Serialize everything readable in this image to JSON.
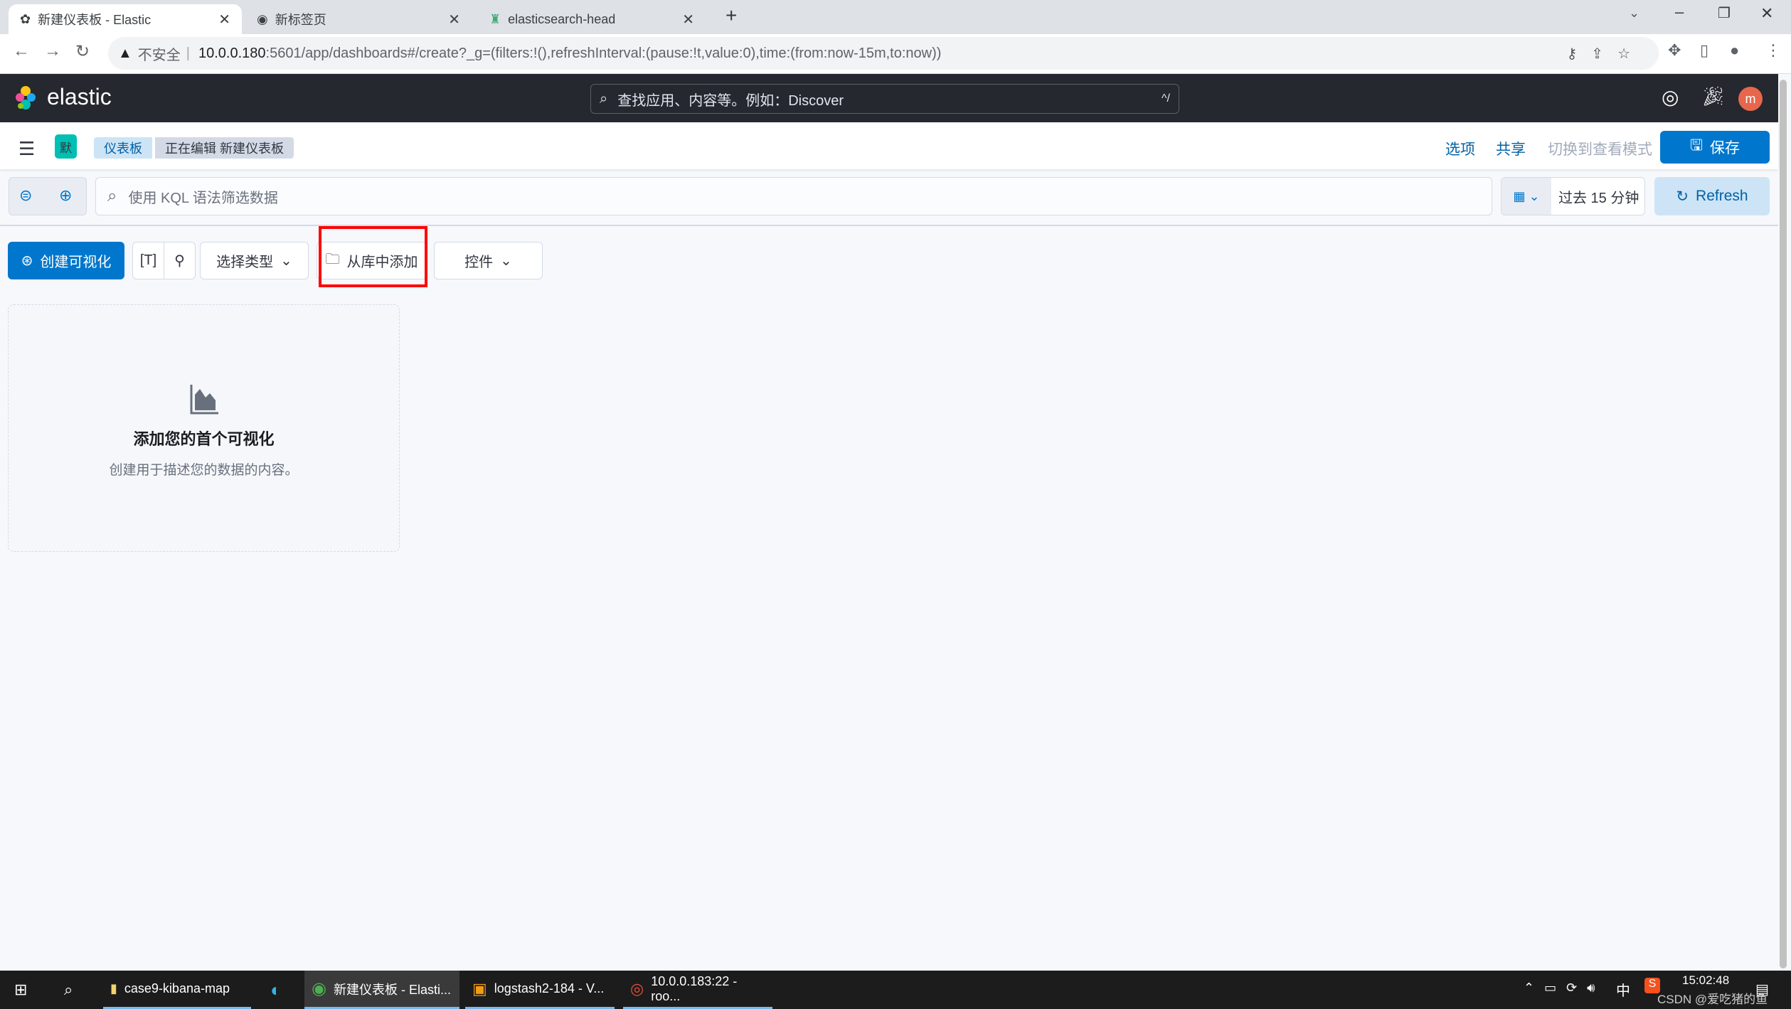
{
  "browser": {
    "tabs": [
      {
        "title": "新建仪表板 - Elastic",
        "active": true
      },
      {
        "title": "新标签页"
      },
      {
        "title": "elasticsearch-head"
      }
    ],
    "security": "不安全",
    "url_host": "10.0.0.180",
    "url_rest": ":5601/app/dashboards#/create?_g=(filters:!(),refreshInterval:(pause:!t,value:0),time:(from:now-15m,to:now))"
  },
  "header": {
    "logo": "elastic",
    "search_placeholder": "查找应用、内容等。例如：Discover",
    "shortcut": "^/",
    "avatar": "m",
    "avatar_color": "#e7664c"
  },
  "nav": {
    "space": "默",
    "breadcrumbs": [
      "仪表板",
      "正在编辑 新建仪表板"
    ],
    "options": "选项",
    "share": "共享",
    "view_mode": "切换到查看模式",
    "save": "保存"
  },
  "query": {
    "placeholder": "使用 KQL 语法筛选数据",
    "time": "过去 15 分钟",
    "refresh": "Refresh"
  },
  "toolbar": {
    "create": "创建可视化",
    "select_type": "选择类型",
    "add_from_library": "从库中添加",
    "controls": "控件"
  },
  "empty": {
    "title": "添加您的首个可视化",
    "desc": "创建用于描述您的数据的内容。"
  },
  "taskbar": {
    "items": [
      "case9-kibana-map",
      "新建仪表板 - Elasti...",
      "logstash2-184 - V...",
      "10.0.0.183:22 - roo..."
    ],
    "ime": "中",
    "time": "15:02:48",
    "watermark": "CSDN @爱吃猪的鱼"
  },
  "colors": {
    "primary": "#0077cc",
    "highlight": "#ff0000"
  }
}
